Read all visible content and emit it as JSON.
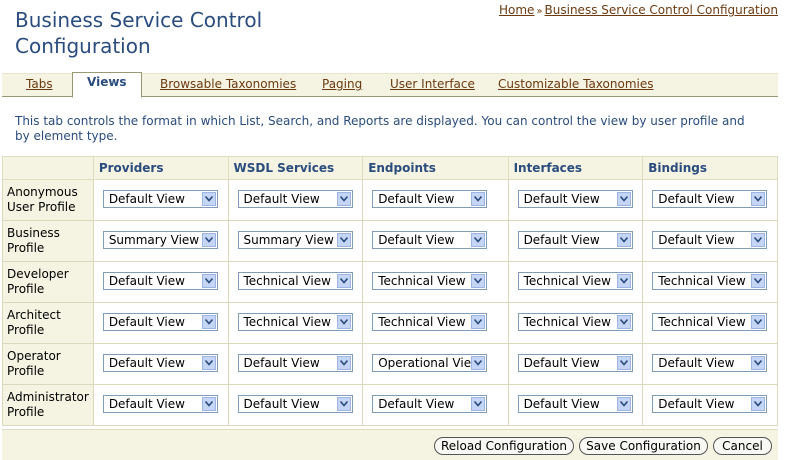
{
  "page": {
    "title": "Business Service Control Configuration"
  },
  "breadcrumb": {
    "home": "Home",
    "separator": "»",
    "current": "Business Service Control Configuration"
  },
  "tabs": [
    {
      "label": "Tabs",
      "active": false
    },
    {
      "label": "Views",
      "active": true
    },
    {
      "label": "Browsable Taxonomies",
      "active": false
    },
    {
      "label": "Paging",
      "active": false
    },
    {
      "label": "User Interface",
      "active": false
    },
    {
      "label": "Customizable Taxonomies",
      "active": false
    }
  ],
  "description": "This tab controls the format in which List, Search, and Reports are displayed. You can control the view by user profile and by element type.",
  "table": {
    "columns": [
      "Providers",
      "WSDL Services",
      "Endpoints",
      "Interfaces",
      "Bindings"
    ],
    "rows": [
      {
        "label_line1": "Anonymous",
        "label_line2": "User Profile",
        "values": [
          "Default View",
          "Default View",
          "Default View",
          "Default View",
          "Default View"
        ]
      },
      {
        "label_line1": "Business",
        "label_line2": "Profile",
        "values": [
          "Summary View",
          "Summary View",
          "Default View",
          "Default View",
          "Default View"
        ]
      },
      {
        "label_line1": "Developer",
        "label_line2": "Profile",
        "values": [
          "Default View",
          "Technical View",
          "Technical View",
          "Technical View",
          "Technical View"
        ]
      },
      {
        "label_line1": "Architect",
        "label_line2": "Profile",
        "values": [
          "Default View",
          "Technical View",
          "Technical View",
          "Technical View",
          "Technical View"
        ]
      },
      {
        "label_line1": "Operator",
        "label_line2": "Profile",
        "values": [
          "Default View",
          "Default View",
          "Operational View",
          "Default View",
          "Default View"
        ]
      },
      {
        "label_line1": "Administrator",
        "label_line2": "Profile",
        "values": [
          "Default View",
          "Default View",
          "Default View",
          "Default View",
          "Default View"
        ]
      }
    ]
  },
  "buttons": {
    "reload": "Reload Configuration",
    "save": "Save Configuration",
    "cancel": "Cancel"
  },
  "colors": {
    "accent": "#2a4c7e",
    "link": "#6b3a10",
    "band": "#f5f3e2"
  }
}
